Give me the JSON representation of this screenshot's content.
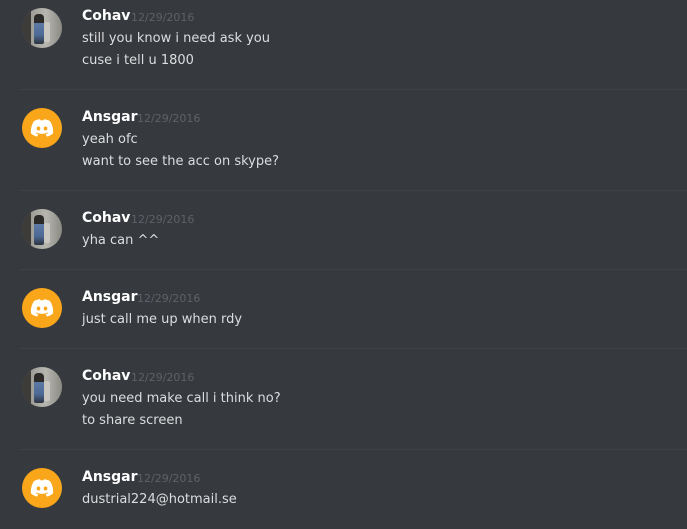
{
  "colors": {
    "background": "#36393e",
    "username": "#ffffff",
    "timestamp": "#5e6166",
    "message_text": "#dcddde",
    "discord_avatar": "#faa61a",
    "divider": "#3e4146"
  },
  "messages": [
    {
      "author": "Cohav",
      "timestamp": "12/29/2016",
      "avatar": "user-photo-avatar",
      "lines": [
        "still you know i need ask you",
        "cuse i tell u 1800"
      ]
    },
    {
      "author": "Ansgar",
      "timestamp": "12/29/2016",
      "avatar": "discord-logo-icon",
      "lines": [
        "yeah ofc",
        "want to see the acc on skype?"
      ]
    },
    {
      "author": "Cohav",
      "timestamp": "12/29/2016",
      "avatar": "user-photo-avatar",
      "lines": [
        "yha can ^^"
      ]
    },
    {
      "author": "Ansgar",
      "timestamp": "12/29/2016",
      "avatar": "discord-logo-icon",
      "lines": [
        "just call me up when rdy"
      ]
    },
    {
      "author": "Cohav",
      "timestamp": "12/29/2016",
      "avatar": "user-photo-avatar",
      "lines": [
        "you need make call i think no?",
        "to share screen"
      ]
    },
    {
      "author": "Ansgar",
      "timestamp": "12/29/2016",
      "avatar": "discord-logo-icon",
      "lines": [
        "dustrial224@hotmail.se"
      ]
    }
  ]
}
